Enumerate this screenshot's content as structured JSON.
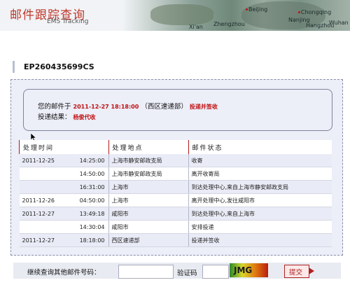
{
  "header": {
    "title": "邮件跟踪查询",
    "subtitle": "EMS Tracking",
    "map_cities": [
      "Beijing",
      "Chongqing",
      "Wuhan",
      "Nanjing",
      "Zhengzhou",
      "Hangzhou",
      "Xi'an"
    ]
  },
  "tracking": {
    "number": "EP260435699CS"
  },
  "summary": {
    "line1_prefix": "您的邮件于",
    "line1_datetime": "2011-12-27 18:18:00",
    "line1_place": "（西区速递部）",
    "line1_status": "投递并签收",
    "line2_prefix": "投递结果：",
    "line2_value": "杨俊代收"
  },
  "table": {
    "headers": [
      "处理时间",
      "处理地点",
      "邮件状态"
    ],
    "rows": [
      {
        "date": "2011-12-25",
        "time": "14:25:00",
        "place": "上海市静安邮政支局",
        "status": "收寄"
      },
      {
        "date": "",
        "time": "14:50:00",
        "place": "上海市静安邮政支局",
        "status": "离开收寄局"
      },
      {
        "date": "",
        "time": "16:31:00",
        "place": "上海市",
        "status": "到达处理中心,来自上海市静安邮政支局"
      },
      {
        "date": "2011-12-26",
        "time": "04:50:00",
        "place": "上海市",
        "status": "离开处理中心,发往咸阳市"
      },
      {
        "date": "2011-12-27",
        "time": "13:49:18",
        "place": "咸阳市",
        "status": "到达处理中心,来自上海市"
      },
      {
        "date": "",
        "time": "14:30:04",
        "place": "咸阳市",
        "status": "安排投递"
      },
      {
        "date": "2011-12-27",
        "time": "18:18:00",
        "place": "西区速递部",
        "status": "投递并签收"
      }
    ]
  },
  "bottom": {
    "query_label": "继续查询其他邮件号码：",
    "query_value": "",
    "captcha_label": "验证码",
    "captcha_value": "",
    "captcha_image_text": "JMG",
    "submit_label": "提交"
  }
}
